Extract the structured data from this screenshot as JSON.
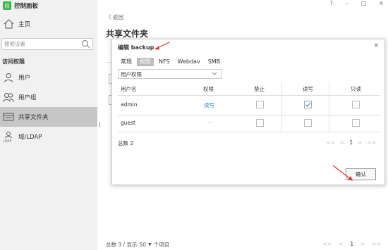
{
  "app": {
    "logo_text": "|||",
    "title": "控制面板"
  },
  "window_controls": {
    "help": "?",
    "minimize": "–",
    "maximize": "□",
    "close": "×"
  },
  "sidebar": {
    "home_label": "主页",
    "search_placeholder": "搜索设置",
    "section_label": "访问权限",
    "items": [
      {
        "label": "用户",
        "icon": "user-icon"
      },
      {
        "label": "用户组",
        "icon": "user-group-icon"
      },
      {
        "label": "共享文件夹",
        "icon": "shared-folder-icon",
        "active": true
      },
      {
        "label": "域/LDAP",
        "icon": "ldap-icon"
      }
    ]
  },
  "main": {
    "back_label": "〈  返回",
    "title": "共享文件夹",
    "footer": {
      "total_label": "总数 3 / 显示",
      "page_size": "50",
      "caret": "▼",
      "items_label": "个项目"
    },
    "footer_pager": {
      "first": "<<",
      "prev": "<",
      "page": "1",
      "next": ">",
      "last": ">>"
    }
  },
  "dialog": {
    "title": "编辑 backup",
    "close": "×",
    "tabs": [
      "常规",
      "权限",
      "NFS",
      "Webdav",
      "SMB"
    ],
    "active_tab": "权限",
    "select_value": "用户权限",
    "columns": [
      "用户名",
      "权限",
      "禁止",
      "读写",
      "只读"
    ],
    "rows": [
      {
        "name": "admin",
        "permission": "读写",
        "deny": false,
        "rw": true,
        "ro": false
      },
      {
        "name": "guest",
        "permission": "-",
        "deny": false,
        "rw": false,
        "ro": false
      }
    ],
    "total": "总数 2",
    "pager": {
      "first": "<<",
      "prev": "<",
      "page": "1",
      "next": ">",
      "last": ">>"
    },
    "ok_label": "确认"
  },
  "colors": {
    "accent_green": "#39b54a",
    "link_blue": "#2b7bd0",
    "arrow_red": "#e03030",
    "active_nav": "#c6c6c6"
  }
}
